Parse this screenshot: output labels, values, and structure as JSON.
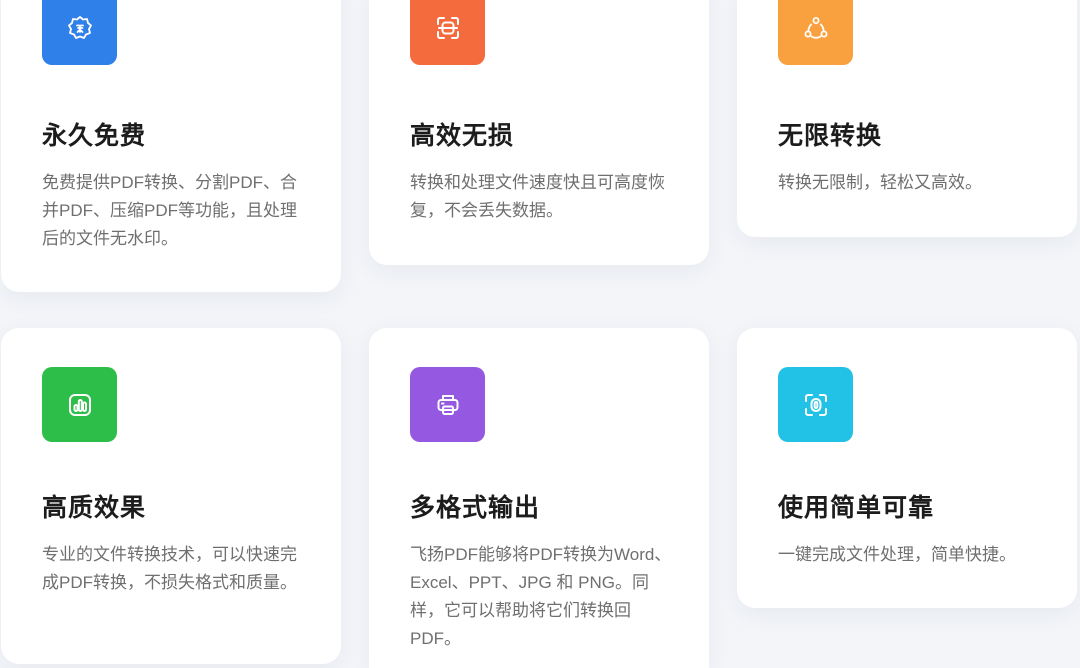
{
  "features": [
    {
      "title": "永久免费",
      "description": "免费提供PDF转换、分割PDF、合并PDF、压缩PDF等功能，且处理后的文件无水印。",
      "icon": "free-badge-icon",
      "color": "#2f80e8"
    },
    {
      "title": "高效无损",
      "description": "转换和处理文件速度快且可高度恢复，不会丢失数据。",
      "icon": "scan-icon",
      "color": "#f46b3e"
    },
    {
      "title": "无限转换",
      "description": "转换无限制，轻松又高效。",
      "icon": "share-nodes-icon",
      "color": "#f9a03f"
    },
    {
      "title": "高质效果",
      "description": "专业的文件转换技术，可以快速完成PDF转换，不损失格式和质量。",
      "icon": "bar-chart-icon",
      "color": "#2dbd49"
    },
    {
      "title": "多格式输出",
      "description": "飞扬PDF能够将PDF转换为Word、Excel、PPT、JPG 和 PNG。同样，它可以帮助将它们转换回 PDF。",
      "icon": "printer-icon",
      "color": "#9558e0"
    },
    {
      "title": "使用简单可靠",
      "description": "一键完成文件处理，简单快捷。",
      "icon": "face-scan-icon",
      "color": "#22c2e6"
    }
  ]
}
